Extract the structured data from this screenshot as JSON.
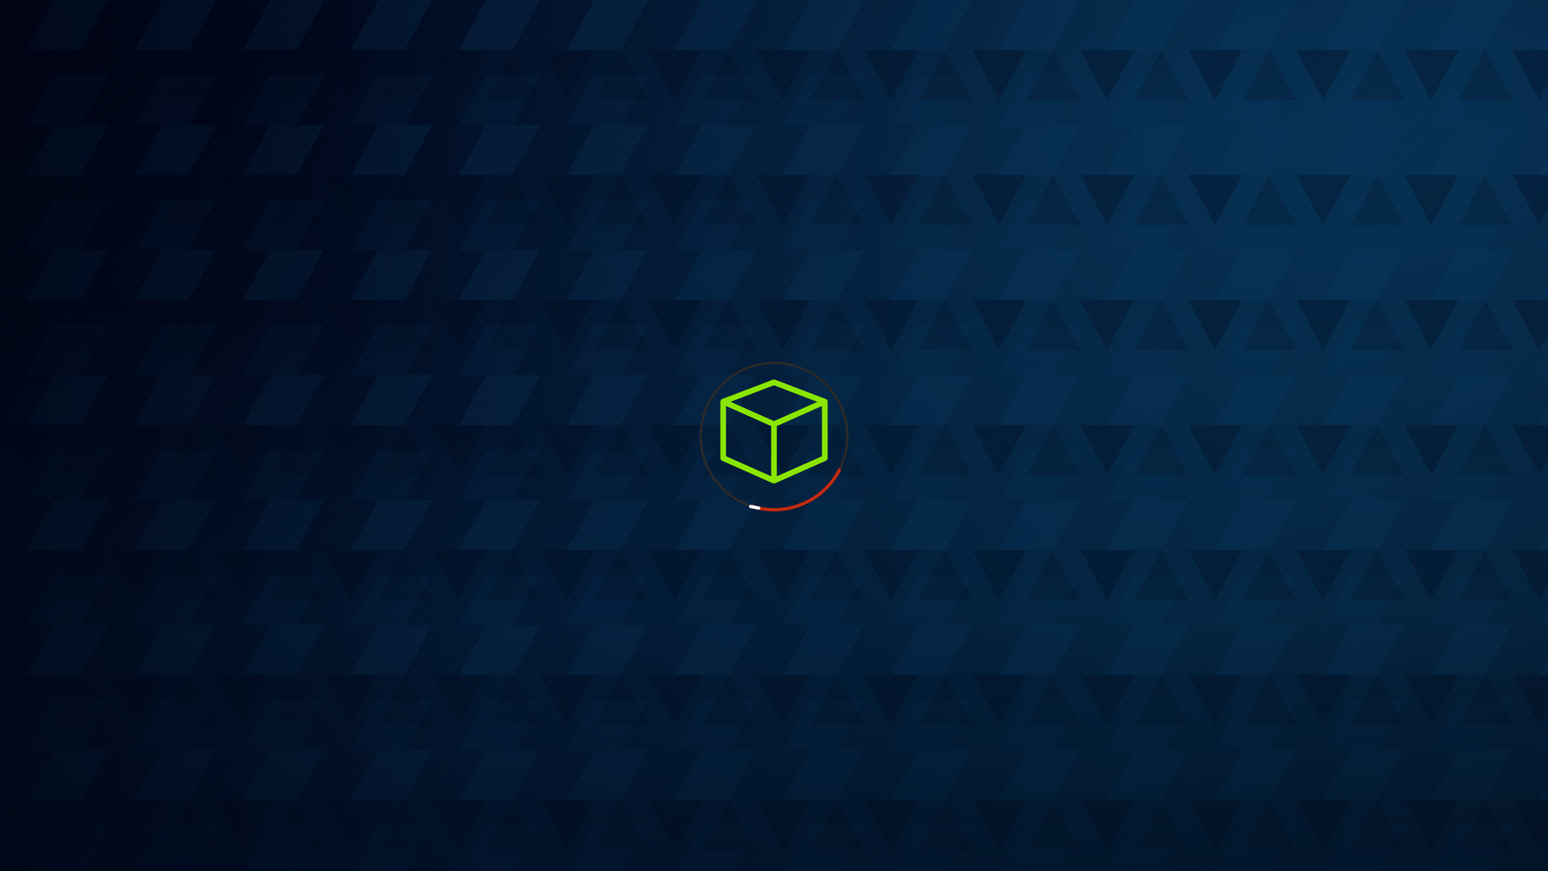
{
  "screen": {
    "state": "loading",
    "background_color": "#021a35"
  },
  "loader": {
    "icon": "cube-icon",
    "icon_color": "#8ae600",
    "ring_color": "#2a2a2a",
    "arc_color": "#c42a10",
    "arc_tip_color": "#ffffff"
  }
}
